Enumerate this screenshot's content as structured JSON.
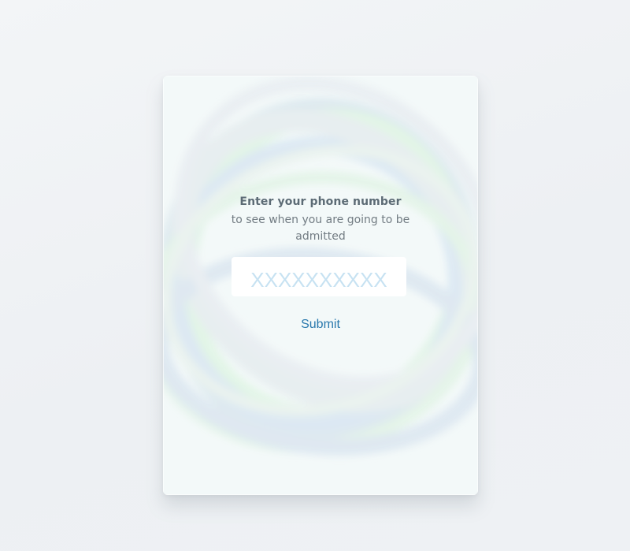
{
  "form": {
    "heading": "Enter your phone number",
    "subtext": "to see when you are going to be admitted",
    "phone_placeholder": "XXXXXXXXXX",
    "phone_value": "",
    "submit_label": "Submit"
  },
  "colors": {
    "page_background": "#eef1f4",
    "card_background": "#f3f9f9",
    "heading_text": "#5c6b75",
    "body_text": "#727c83",
    "placeholder_text": "#c7e2f2",
    "submit_text": "#2a79ad"
  },
  "decoration": {
    "card_background_art": "watercolor-swirl"
  }
}
